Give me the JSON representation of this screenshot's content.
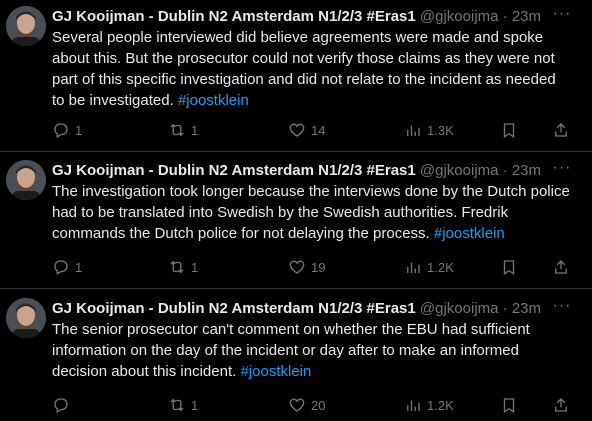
{
  "tweets": [
    {
      "author": "GJ Kooijman - Dublin N2 Amsterdam N1/2/3 #Eras1",
      "handle": "@gjkooijma",
      "separator": "·",
      "time": "23m",
      "more": "···",
      "text": "Several people interviewed did believe agreements were made and spoke about this. But the prosecutor could not verify those claims as they were not part of this specific investigation and did not relate to the incident as needed to be investigated.",
      "hashtag": "#joostklein",
      "replies": "1",
      "reposts": "1",
      "likes": "14",
      "views": "1.3K"
    },
    {
      "author": "GJ Kooijman - Dublin N2 Amsterdam N1/2/3 #Eras1",
      "handle": "@gjkooijma",
      "separator": "·",
      "time": "23m",
      "more": "···",
      "text": "The investigation took longer because the interviews done by the Dutch police had to be translated into Swedish by the Swedish authorities. Fredrik commands the Dutch police for not delaying the process.",
      "hashtag": "#joostklein",
      "replies": "1",
      "reposts": "1",
      "likes": "19",
      "views": "1.2K"
    },
    {
      "author": "GJ Kooijman - Dublin N2 Amsterdam N1/2/3 #Eras1",
      "handle": "@gjkooijma",
      "separator": "·",
      "time": "23m",
      "more": "···",
      "text": "The senior prosecutor can't comment on whether the EBU had sufficient information on the day of the incident or day after to make an informed decision about this incident.",
      "hashtag": "#joostklein",
      "replies": "",
      "reposts": "1",
      "likes": "20",
      "views": "1.2K"
    }
  ],
  "icons": {
    "reply": "reply-icon",
    "repost": "repost-icon",
    "like": "heart-icon",
    "views": "views-icon",
    "bookmark": "bookmark-icon",
    "share": "share-icon"
  },
  "colors": {
    "background": "#000000",
    "text": "#e7e9ea",
    "muted": "#71767b",
    "link": "#1d9bf0",
    "divider": "#2f3336"
  }
}
